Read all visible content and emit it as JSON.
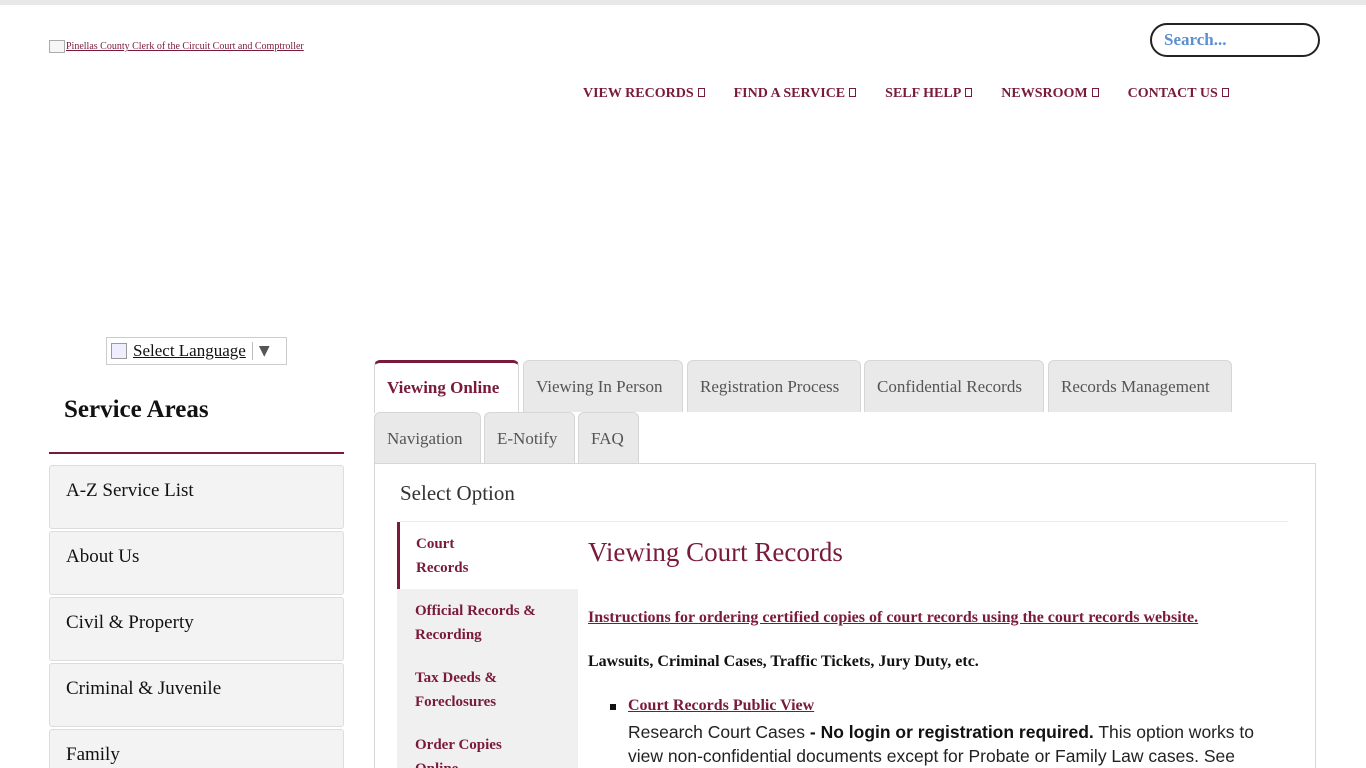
{
  "header": {
    "logo_alt": "Pinellas County Clerk of the Circuit Court and Comptroller",
    "search_placeholder": "Search..."
  },
  "nav": {
    "items": [
      {
        "label": "VIEW RECORDS"
      },
      {
        "label": "FIND A SERVICE"
      },
      {
        "label": "SELF HELP"
      },
      {
        "label": "NEWSROOM"
      },
      {
        "label": "CONTACT US"
      }
    ]
  },
  "language": {
    "label": "Select Language",
    "arrow": "▼"
  },
  "sidebar": {
    "title": "Service Areas",
    "items": [
      {
        "label": "A-Z Service List"
      },
      {
        "label": "About Us"
      },
      {
        "label": "Civil & Property"
      },
      {
        "label": "Criminal & Juvenile"
      },
      {
        "label": "Family"
      }
    ]
  },
  "tabs": [
    {
      "label": "Viewing Online",
      "active": true
    },
    {
      "label": "Viewing In Person"
    },
    {
      "label": "Registration Process"
    },
    {
      "label": "Confidential Records"
    },
    {
      "label": "Records Management"
    },
    {
      "label": "Navigation"
    },
    {
      "label": "E-Notify"
    },
    {
      "label": "FAQ"
    }
  ],
  "panel": {
    "select_option": "Select Option",
    "options": [
      {
        "line1": "Court",
        "line2": "Records",
        "active": true
      },
      {
        "line1": "Official Records &",
        "line2": "Recording"
      },
      {
        "line1": "Tax Deeds &",
        "line2": "Foreclosures"
      },
      {
        "line1": "Order Copies",
        "line2": "Online"
      }
    ],
    "title": "Viewing Court Records",
    "instructions_link": "Instructions for ordering certified copies of court records using the court records website.",
    "subheading": "Lawsuits, Criminal Cases, Traffic Tickets, Jury Duty, etc.",
    "public_view_link": "Court Records Public View",
    "desc_part1": "Research Court Cases ",
    "desc_bold": "- No login or registration required.",
    "desc_part2": " This option works to view non-confidential documents except for Probate or Family Law cases.  See"
  },
  "colors": {
    "brand": "#7a1a3a",
    "search_text": "#5a8fd0"
  }
}
